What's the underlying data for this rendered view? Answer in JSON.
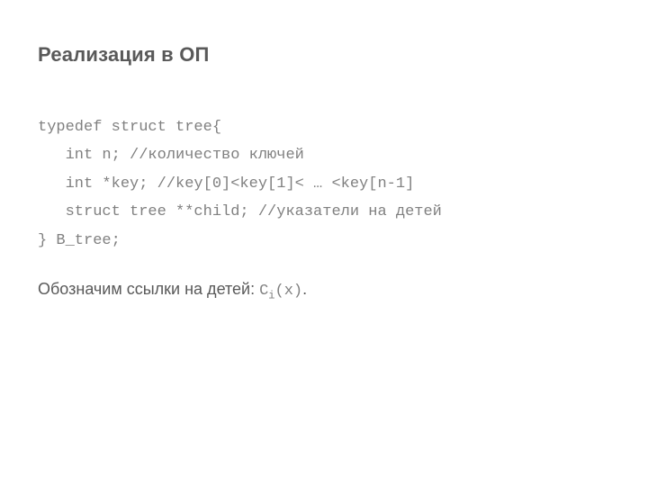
{
  "title": "Реализация в ОП",
  "code": {
    "l1": "typedef struct tree{",
    "l2": "   int n; //количество ключей",
    "l3": "   int *key; //key[0]<key[1]< … <key[n-1]",
    "l4": "   struct tree **child; //указатели на детей",
    "l5": "} B_tree;"
  },
  "note": {
    "prefix": "Обозначим ссылки на детей: ",
    "c": "C",
    "sub": "i",
    "paren": "(x)",
    "period": "."
  }
}
